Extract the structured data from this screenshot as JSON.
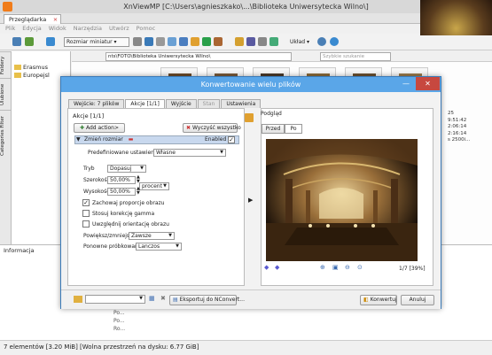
{
  "window": {
    "title": "XnViewMP [C:\\Users\\agnieszkako\\...\\Biblioteka Uniwersytecka Wilno\\]",
    "controls": [
      "—",
      "□",
      "×"
    ]
  },
  "tabs": [
    {
      "label": "Przeglądarka"
    }
  ],
  "menu": [
    "Plik",
    "Edycja",
    "Widok",
    "Narzędzia",
    "Utwórz",
    "Pomoc"
  ],
  "toolbar": {
    "thumbs_dropdown": "Rozmiar miniatur",
    "layout_dropdown": "Układ"
  },
  "left_tabs": [
    "Foldery",
    "Ulubione",
    "Categories Filter"
  ],
  "tree": [
    {
      "label": "Erasmus"
    },
    {
      "label": "Europejsl"
    }
  ],
  "address": {
    "value": "nts\\FOTO\\Biblioteka Uniwersytecka Wilno\\",
    "search_placeholder": "Szybkie szukanie"
  },
  "right_info": [
    "25",
    "9:51:42",
    "2:06:14",
    "2:16:14",
    "s 2500i..."
  ],
  "info_panel": {
    "title": "Informacja",
    "items": [
      "Po...",
      "Po...",
      "Ro..."
    ]
  },
  "status": "7 elementów [3.20 MiB] [Wolna przestrzeń na dysku: 6.77 GiB]",
  "dialog": {
    "title": "Konwertowanie wielu plików",
    "tabs": [
      {
        "label": "Wejście: 7 plików",
        "state": "normal"
      },
      {
        "label": "Akcje [1/1]",
        "state": "active"
      },
      {
        "label": "Wyjście",
        "state": "normal"
      },
      {
        "label": "Stan",
        "state": "disabled"
      },
      {
        "label": "Ustawienia",
        "state": "normal"
      }
    ],
    "actions_caption": "Akcje [1/1]",
    "add_action": "Add action>",
    "clear_all": "Wyczyść wszystko",
    "action_name": "Zmień rozmiar",
    "enabled_label": "Enabled",
    "preset_label": "Predefiniowane ustawienia",
    "preset_value": "Własne",
    "mode_label": "Tryb",
    "mode_value": "Dopasuj",
    "width_label": "Szerokość",
    "width_value": "50,00%",
    "height_label": "Wysokość",
    "height_value": "50,00%",
    "unit_value": "procent",
    "keep_ratio": "Zachowaj proporcje obrazu",
    "gamma": "Stosuj korekcję gamma",
    "orientation": "Uwzględnij orientację obrazu",
    "enlarge_label": "Powiększ/zmniejsz",
    "enlarge_value": "Zawsze",
    "resample_label": "Ponowne próbkowanie",
    "resample_value": "Lanczos",
    "preview_caption": "Podgląd",
    "before_tab": "Przed",
    "after_tab": "Po",
    "page_info": "1/7 [39%]",
    "export_button": "Eksportuj do NConvert...",
    "convert_button": "Konwertuj",
    "cancel_button": "Anuluj"
  }
}
